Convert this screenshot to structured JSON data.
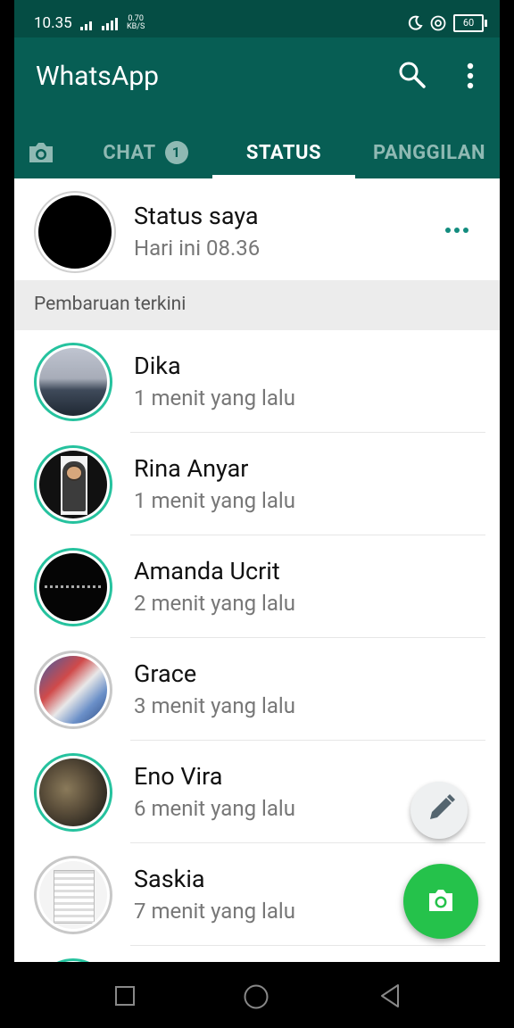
{
  "status_bar": {
    "time": "10.35",
    "net_speed_value": "0.70",
    "net_speed_unit": "KB/S",
    "battery": "60"
  },
  "app": {
    "title": "WhatsApp"
  },
  "tabs": [
    {
      "label": "CHAT",
      "badge": "1"
    },
    {
      "label": "STATUS",
      "active": true
    },
    {
      "label": "PANGGILAN"
    }
  ],
  "my_status": {
    "name": "Status saya",
    "time": "Hari ini 08.36"
  },
  "section_title": "Pembaruan terkini",
  "updates": [
    {
      "name": "Dika",
      "time": "1 menit yang lalu"
    },
    {
      "name": "Rina Anyar",
      "time": "1 menit yang lalu"
    },
    {
      "name": "Amanda Ucrit",
      "time": "2 menit yang lalu"
    },
    {
      "name": "Grace",
      "time": "3 menit yang lalu"
    },
    {
      "name": "Eno Vira",
      "time": "6 menit yang lalu"
    },
    {
      "name": "Saskia",
      "time": "7 menit yang lalu"
    }
  ],
  "colors": {
    "header": "#075e54",
    "accent": "#25c29e",
    "fab": "#25c24b"
  }
}
